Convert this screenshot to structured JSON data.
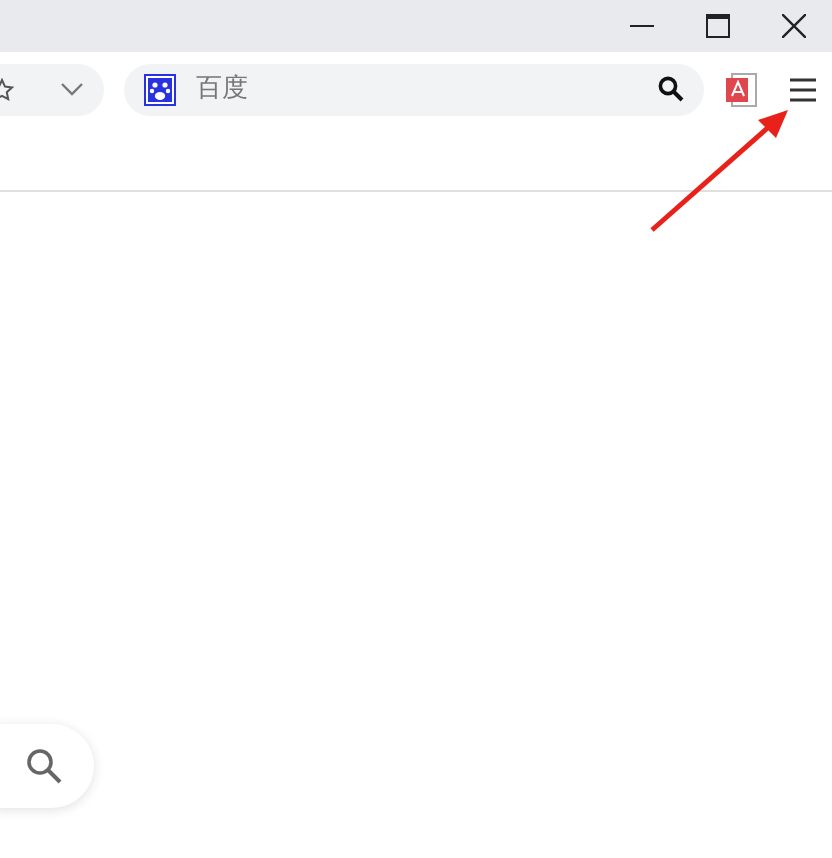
{
  "address_bar": {
    "placeholder": "百度"
  }
}
